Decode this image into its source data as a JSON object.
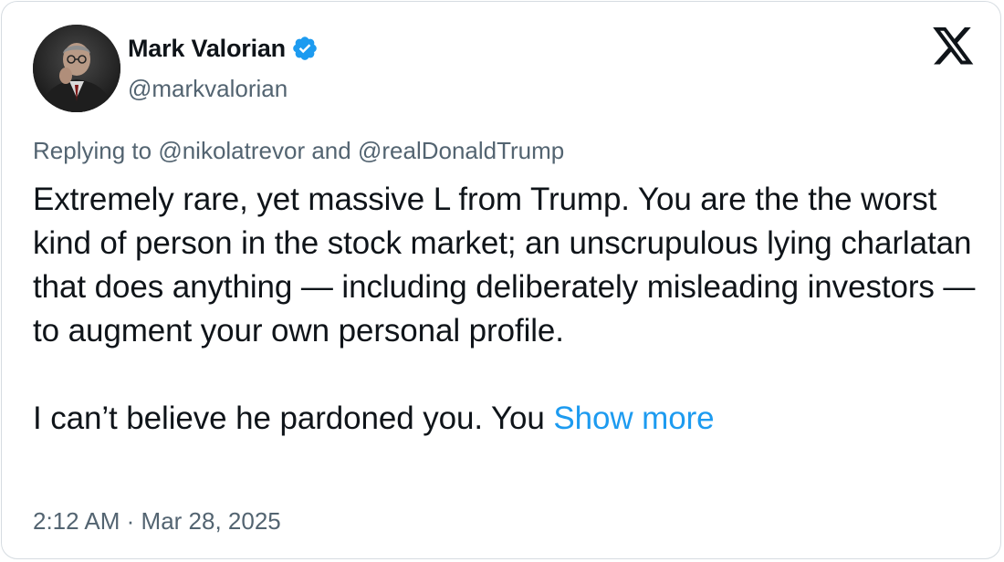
{
  "author": {
    "display_name": "Mark Valorian",
    "handle": "@markvalorian",
    "verified": true,
    "avatar_icon": "profile-photo"
  },
  "brand": {
    "logo_icon": "x-logo-icon"
  },
  "reply_context": {
    "prefix": "Replying to",
    "mention_1": "@nikolatrevor",
    "conjunction": "and",
    "mention_2": "@realDonaldTrump"
  },
  "tweet": {
    "paragraph_1": "Extremely rare, yet massive L from Trump. You are the the worst kind of person in the stock market; an unscrupulous lying charlatan that does anything — including deliberately misleading investors — to augment your own personal profile.",
    "paragraph_2": "I can’t believe he pardoned you. You",
    "show_more": "Show more"
  },
  "meta": {
    "time": "2:12 AM",
    "separator": "·",
    "date": "Mar 28, 2025"
  },
  "colors": {
    "text_primary": "#0f1419",
    "text_secondary": "#536471",
    "link": "#1d9bf0",
    "verified_badge": "#1d9bf0",
    "border": "#d6dce1"
  }
}
